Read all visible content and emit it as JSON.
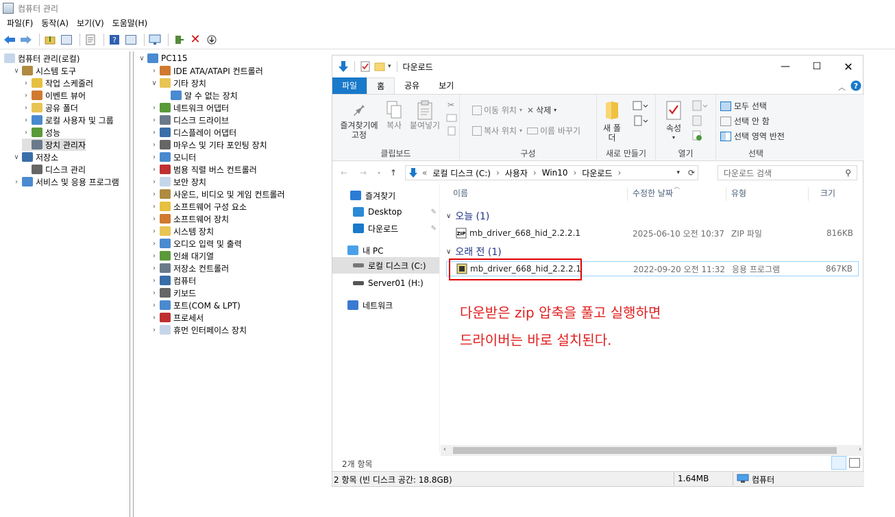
{
  "app": {
    "title": "컴퓨터 관리"
  },
  "menu": [
    "파일(F)",
    "동작(A)",
    "보기(V)",
    "도움말(H)"
  ],
  "left_tree": [
    {
      "label": "컴퓨터 관리(로컬)",
      "level": 0,
      "chev": ""
    },
    {
      "label": "시스템 도구",
      "level": 1,
      "chev": "v"
    },
    {
      "label": "작업 스케줄러",
      "level": 2,
      "chev": ">"
    },
    {
      "label": "이벤트 뷰어",
      "level": 2,
      "chev": ">"
    },
    {
      "label": "공유 폴더",
      "level": 2,
      "chev": ">"
    },
    {
      "label": "로컬 사용자 및 그룹",
      "level": 2,
      "chev": ">"
    },
    {
      "label": "성능",
      "level": 2,
      "chev": ">"
    },
    {
      "label": "장치 관리자",
      "level": 2,
      "chev": ""
    },
    {
      "label": "저장소",
      "level": 1,
      "chev": "v"
    },
    {
      "label": "디스크 관리",
      "level": 2,
      "chev": ""
    },
    {
      "label": "서비스 및 응용 프로그램",
      "level": 1,
      "chev": ">"
    }
  ],
  "device_tree": {
    "root": "PC115",
    "items": [
      {
        "label": "IDE ATA/ATAPI 컨트롤러",
        "chev": ">"
      },
      {
        "label": "기타 장치",
        "chev": "v"
      },
      {
        "label": "알 수 없는 장치",
        "chev": "",
        "child": true
      },
      {
        "label": "네트워크 어댑터",
        "chev": ">"
      },
      {
        "label": "디스크 드라이브",
        "chev": ">"
      },
      {
        "label": "디스플레이 어댑터",
        "chev": ">"
      },
      {
        "label": "마우스 및 기타 포인팅 장치",
        "chev": ">"
      },
      {
        "label": "모니터",
        "chev": ">"
      },
      {
        "label": "범용 직렬 버스 컨트롤러",
        "chev": ">"
      },
      {
        "label": "보안 장치",
        "chev": ">"
      },
      {
        "label": "사운드, 비디오 및 게임 컨트롤러",
        "chev": ">"
      },
      {
        "label": "소프트웨어 구성 요소",
        "chev": ">"
      },
      {
        "label": "소프트웨어 장치",
        "chev": ">"
      },
      {
        "label": "시스템 장치",
        "chev": ">"
      },
      {
        "label": "오디오 입력 및 출력",
        "chev": ">"
      },
      {
        "label": "인쇄 대기열",
        "chev": ">"
      },
      {
        "label": "저장소 컨트롤러",
        "chev": ">"
      },
      {
        "label": "컴퓨터",
        "chev": ">"
      },
      {
        "label": "키보드",
        "chev": ">"
      },
      {
        "label": "포트(COM & LPT)",
        "chev": ">"
      },
      {
        "label": "프로세서",
        "chev": ">"
      },
      {
        "label": "휴먼 인터페이스 장치",
        "chev": ">"
      }
    ]
  },
  "explorer": {
    "title": "다운로드",
    "tabs": [
      "파일",
      "홈",
      "공유",
      "보기"
    ],
    "ribbon": {
      "pin": "즐겨찾기에 고정",
      "copy": "복사",
      "paste": "붙여넣기",
      "clipboard_group": "클립보드",
      "move_to": "이동 위치",
      "copy_to": "복사 위치",
      "delete": "삭제",
      "rename": "이름 바꾸기",
      "organize_group": "구성",
      "new_folder": "새 폴더",
      "new_group": "새로 만들기",
      "properties": "속성",
      "open_group": "열기",
      "select_all": "모두 선택",
      "select_none": "선택 안 함",
      "invert_selection": "선택 영역 반전",
      "select_group": "선택"
    },
    "address": {
      "root": "«",
      "parts": [
        "로컬 디스크 (C:)",
        "사용자",
        "Win10",
        "다운로드"
      ]
    },
    "search_placeholder": "다운로드 검색",
    "nav": [
      {
        "label": "즐겨찾기",
        "icon": "star-icon"
      },
      {
        "label": "Desktop",
        "icon": "desktop-icon"
      },
      {
        "label": "다운로드",
        "icon": "download-icon"
      },
      {
        "label": "내 PC",
        "icon": "pc-icon"
      },
      {
        "label": "로컬 디스크 (C:)",
        "icon": "drive-icon"
      },
      {
        "label": "Server01 (H:)",
        "icon": "network-drive-icon"
      },
      {
        "label": "네트워크",
        "icon": "network-icon"
      }
    ],
    "columns": [
      "이름",
      "수정한 날짜",
      "유형",
      "크기"
    ],
    "groups": [
      {
        "label": "오늘 (1)",
        "files": [
          {
            "name": "mb_driver_668_hid_2.2.2.1",
            "date": "2025-06-10 오전 10:37",
            "type": "ZIP 파일",
            "size": "816KB"
          }
        ]
      },
      {
        "label": "오래 전 (1)",
        "files": [
          {
            "name": "mb_driver_668_hid_2.2.2.1",
            "date": "2022-09-20 오전 11:32",
            "type": "응용 프로그램",
            "size": "867KB"
          }
        ]
      }
    ],
    "annotation": [
      "다운받은 zip 압축을 풀고 실행하면",
      "드라이버는 바로 설치된다."
    ],
    "item_count": "2개 항목",
    "status": {
      "left": "2 항목 (빈 디스크 공간: 18.8GB)",
      "size": "1.64MB",
      "location": "컴퓨터"
    }
  },
  "colors": {
    "accent": "#1979ca",
    "annotation": "#e02020"
  }
}
